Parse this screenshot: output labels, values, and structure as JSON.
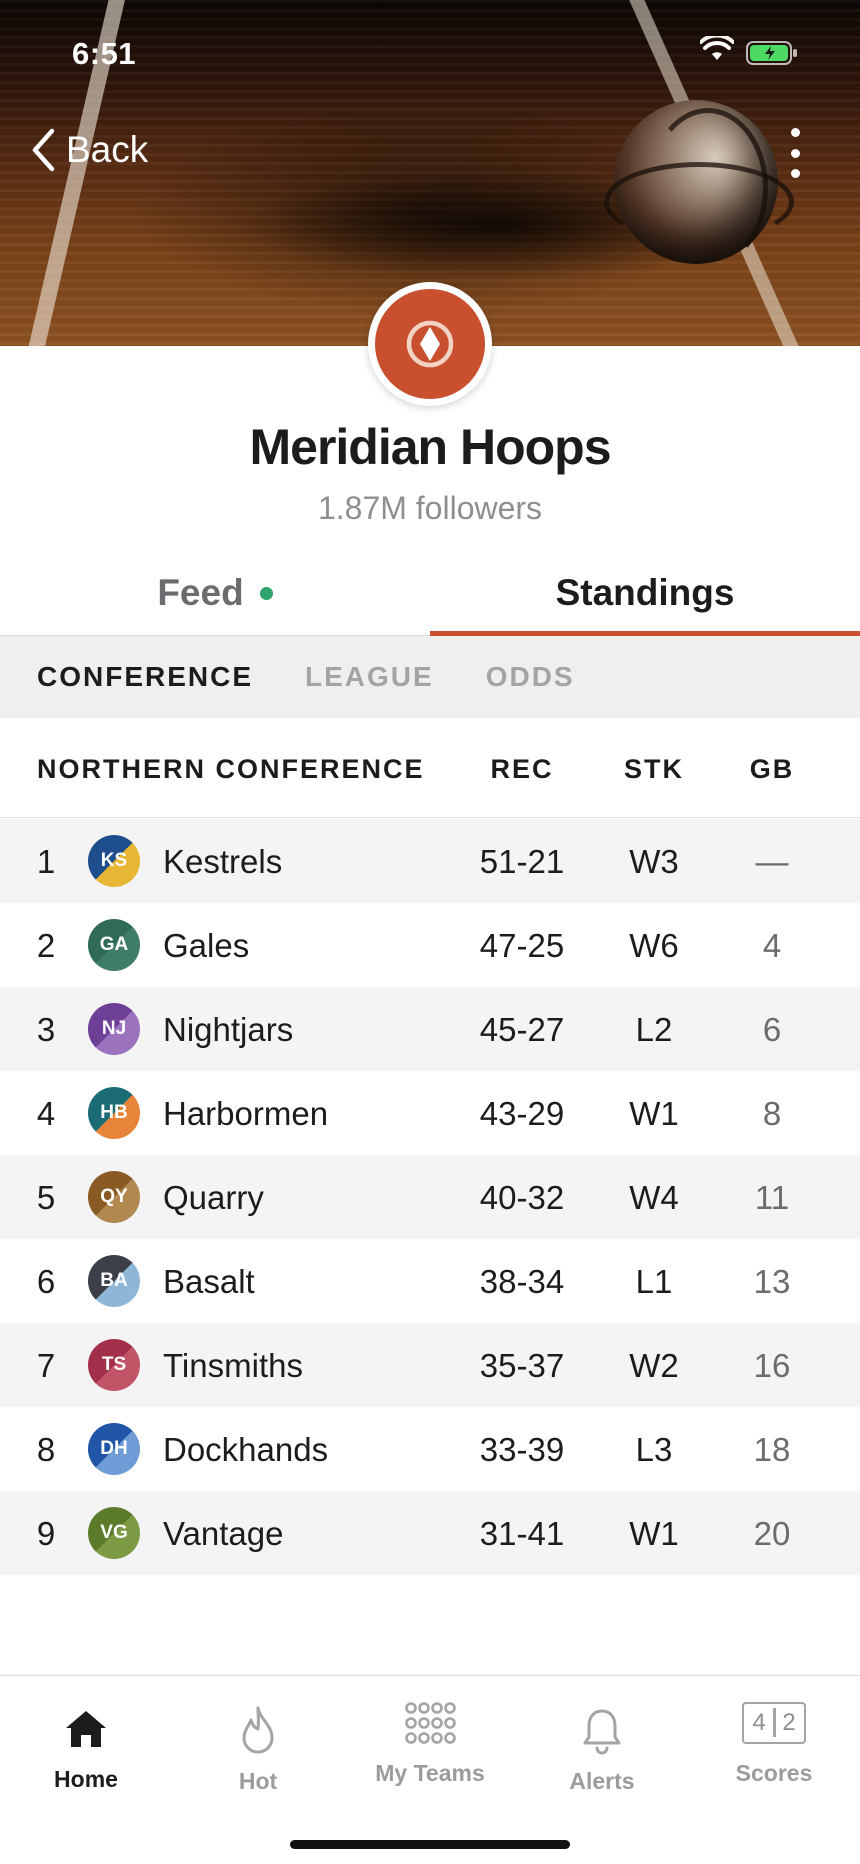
{
  "status_bar": {
    "time": "6:51",
    "battery_color": "#4cd964"
  },
  "nav": {
    "back_label": "Back"
  },
  "team": {
    "name": "Meridian Hoops",
    "followers": "1.87M followers",
    "brand_color": "#c9502f"
  },
  "tabs": [
    {
      "label": "Feed",
      "active": false,
      "has_dot": true,
      "dot_color": "#2fa36b"
    },
    {
      "label": "Standings",
      "active": true
    }
  ],
  "subtabs": [
    {
      "label": "CONFERENCE",
      "active": true
    },
    {
      "label": "LEAGUE",
      "active": false
    },
    {
      "label": "ODDS",
      "active": false
    }
  ],
  "table": {
    "columns": {
      "conference": "NORTHERN CONFERENCE",
      "rec": "REC",
      "stk": "STK",
      "gb": "GB"
    },
    "rows": [
      {
        "rank": "1",
        "abbr": "KS",
        "name": "Kestrels",
        "rec": "51-21",
        "stk": "W3",
        "gb": "—",
        "color_a": "#1f4e8c",
        "color_b": "#e6b634"
      },
      {
        "rank": "2",
        "abbr": "GA",
        "name": "Gales",
        "rec": "47-25",
        "stk": "W6",
        "gb": "4",
        "color_a": "#2f6b55",
        "color_b": "#3f7d66"
      },
      {
        "rank": "3",
        "abbr": "NJ",
        "name": "Nightjars",
        "rec": "45-27",
        "stk": "L2",
        "gb": "6",
        "color_a": "#6e3f96",
        "color_b": "#9a72bd"
      },
      {
        "rank": "4",
        "abbr": "HB",
        "name": "Harbormen",
        "rec": "43-29",
        "stk": "W1",
        "gb": "8",
        "color_a": "#1b6c74",
        "color_b": "#e8833a"
      },
      {
        "rank": "5",
        "abbr": "QY",
        "name": "Quarry",
        "rec": "40-32",
        "stk": "W4",
        "gb": "11",
        "color_a": "#8a5a24",
        "color_b": "#b08850"
      },
      {
        "rank": "6",
        "abbr": "BA",
        "name": "Basalt",
        "rec": "38-34",
        "stk": "L1",
        "gb": "13",
        "color_a": "#3a3f48",
        "color_b": "#8fb6d6"
      },
      {
        "rank": "7",
        "abbr": "TS",
        "name": "Tinsmiths",
        "rec": "35-37",
        "stk": "W2",
        "gb": "16",
        "color_a": "#a3304a",
        "color_b": "#c25468"
      },
      {
        "rank": "8",
        "abbr": "DH",
        "name": "Dockhands",
        "rec": "33-39",
        "stk": "L3",
        "gb": "18",
        "color_a": "#2156a6",
        "color_b": "#6f9bd6"
      },
      {
        "rank": "9",
        "abbr": "VG",
        "name": "Vantage",
        "rec": "31-41",
        "stk": "W1",
        "gb": "20",
        "color_a": "#5b7a2a",
        "color_b": "#7d9a44"
      }
    ]
  },
  "bottom_nav": [
    {
      "label": "Home",
      "icon": "home-icon",
      "active": true
    },
    {
      "label": "Hot",
      "icon": "flame-icon",
      "active": false
    },
    {
      "label": "My Teams",
      "icon": "grid-dots-icon",
      "active": false
    },
    {
      "label": "Alerts",
      "icon": "bell-icon",
      "active": false
    },
    {
      "label": "Scores",
      "icon": "scoreboard-icon",
      "active": false,
      "score_left": "4",
      "score_right": "2"
    }
  ]
}
